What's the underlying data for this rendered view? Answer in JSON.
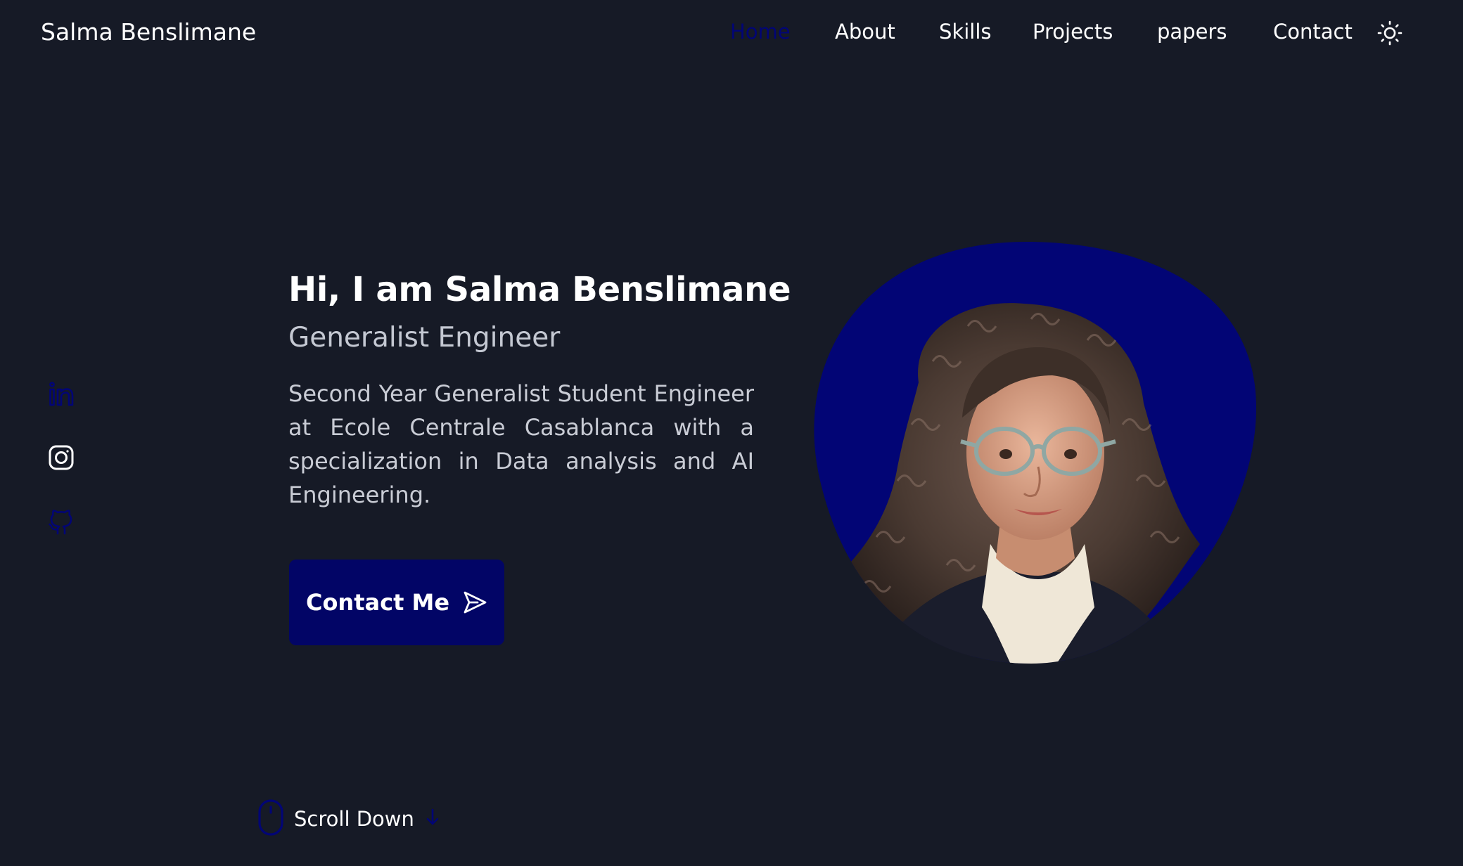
{
  "header": {
    "brand": "Salma Benslimane",
    "nav": [
      {
        "label": "Home",
        "active": true
      },
      {
        "label": "About",
        "active": false
      },
      {
        "label": "Skills",
        "active": false
      },
      {
        "label": "Projects",
        "active": false
      },
      {
        "label": "papers",
        "active": false
      },
      {
        "label": "Contact",
        "active": false
      }
    ],
    "theme_icon": "sun-icon"
  },
  "social": [
    {
      "name": "linkedin-icon"
    },
    {
      "name": "instagram-icon"
    },
    {
      "name": "github-icon"
    }
  ],
  "hero": {
    "title": "Hi, I am Salma Benslimane",
    "subtitle": "Generalist Engineer",
    "description": "Second Year Generalist Student Engineer at Ecole Centrale Casablanca with a specialization in Data analysis and AI Engineering.",
    "cta_label": "Contact Me",
    "cta_icon": "send-icon"
  },
  "scroll": {
    "label": "Scroll Down",
    "mouse_icon": "mouse-icon",
    "arrow_icon": "arrow-down-icon"
  },
  "colors": {
    "background": "#161a26",
    "accent": "#020575",
    "text": "#ffffff",
    "muted_text": "#c9ccd5"
  }
}
